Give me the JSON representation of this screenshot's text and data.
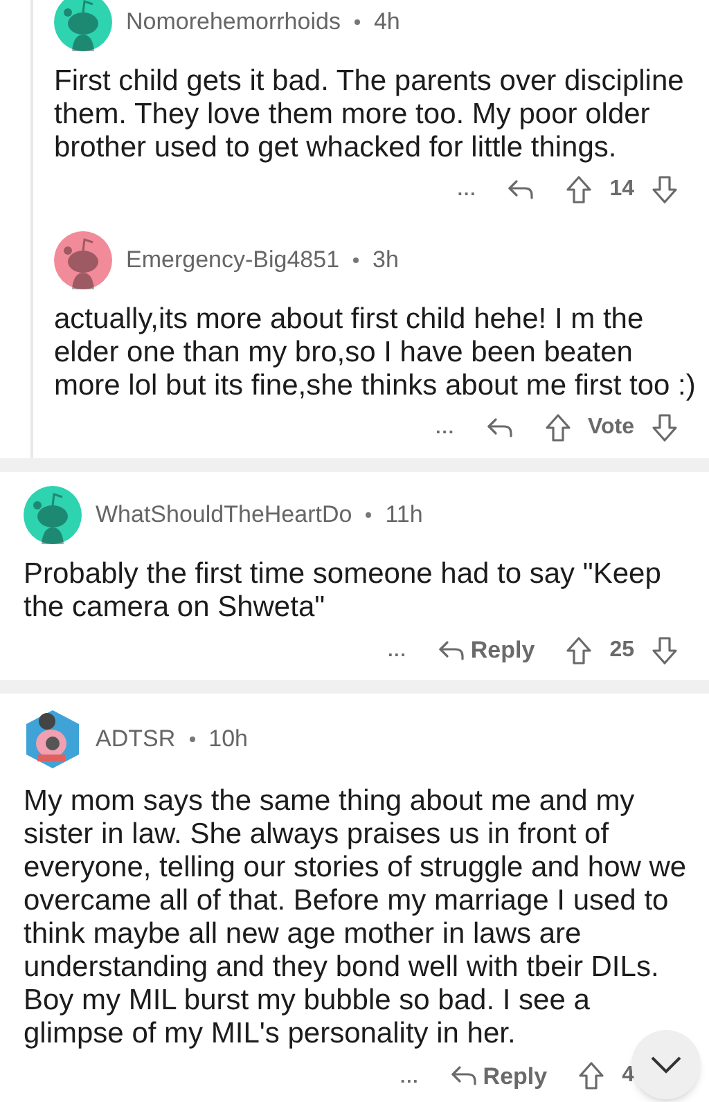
{
  "threads": [
    {
      "author": "Nomorehemorrhoids",
      "age": "4h",
      "avatar": {
        "kind": "snoo",
        "color": "#2ed3b0"
      },
      "body": "First child gets it bad. The parents over discipline them. They love them more too. My poor older brother used to get whacked for little things.",
      "actions": {
        "more": "...",
        "score": "14"
      },
      "replies": [
        {
          "author": "Emergency-Big4851",
          "age": "3h",
          "avatar": {
            "kind": "snoo",
            "color": "#f28b99"
          },
          "body": "actually,its more about first child hehe! I m the elder one than my bro,so I have been beaten more lol but its fine,she thinks about me first too :)",
          "actions": {
            "more": "...",
            "score": "Vote"
          }
        }
      ]
    },
    {
      "author": "WhatShouldTheHeartDo",
      "age": "11h",
      "avatar": {
        "kind": "snoo",
        "color": "#2ed3b0"
      },
      "body": "Probably the first time someone had to say \"Keep the camera on Shweta\"",
      "actions": {
        "more": "...",
        "reply_label": "Reply",
        "score": "25"
      }
    },
    {
      "author": "ADTSR",
      "age": "10h",
      "avatar": {
        "kind": "custom",
        "color": "#3fa3d8"
      },
      "body": "My mom says the same thing about me and my sister in law. She always praises us in front of everyone, telling our stories of struggle and how we overcame all of that. Before my marriage I used to think maybe all new age mother in laws are understanding and they bond well with tbeir DILs. Boy my MIL burst my bubble so bad. I see a glimpse of my MIL's personality in her.",
      "actions": {
        "more": "...",
        "reply_label": "Reply",
        "score": "4"
      },
      "floating_scroll_button": true
    }
  ]
}
